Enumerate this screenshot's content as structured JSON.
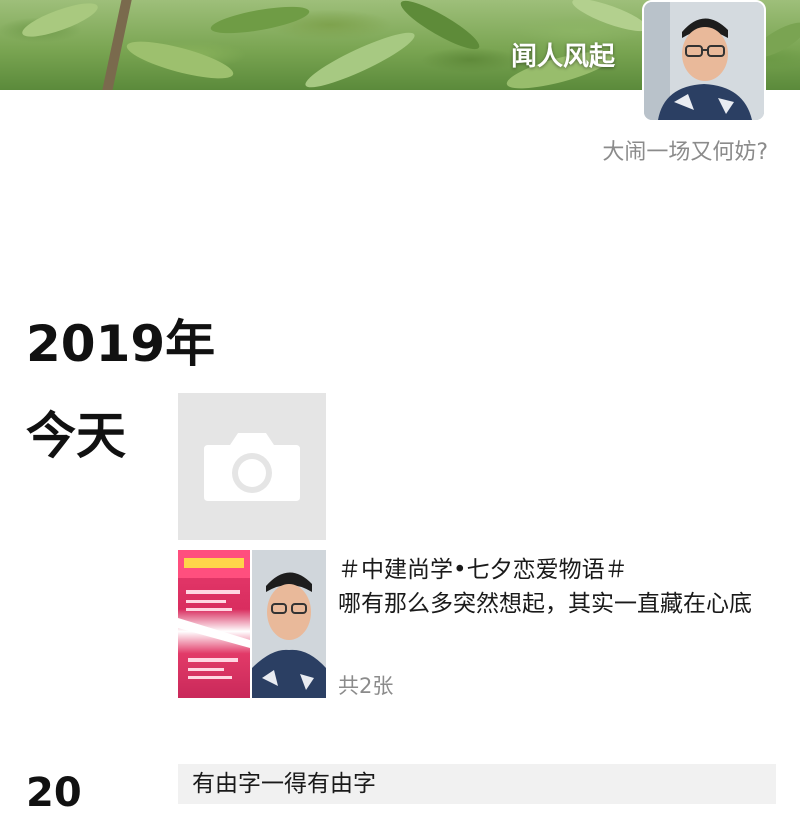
{
  "cover": {
    "name": "闻人风起"
  },
  "profile": {
    "signature": "大闹一场又何妨?"
  },
  "timeline": {
    "year": "2019年",
    "entries": [
      {
        "date": "今天",
        "post_text_line1": "＃中建尚学•七夕恋爱物语＃",
        "post_text_body": "哪有那么多突然想起，其实一直藏在心底",
        "image_count": "共2张"
      }
    ],
    "next_entry": {
      "date": "20",
      "text": "有由字一得有由字"
    }
  },
  "icons": {
    "camera": "camera-icon"
  },
  "colors": {
    "muted": "#8b8b8b",
    "tile": "#e5e5e5",
    "poster": "#e83c6e"
  }
}
